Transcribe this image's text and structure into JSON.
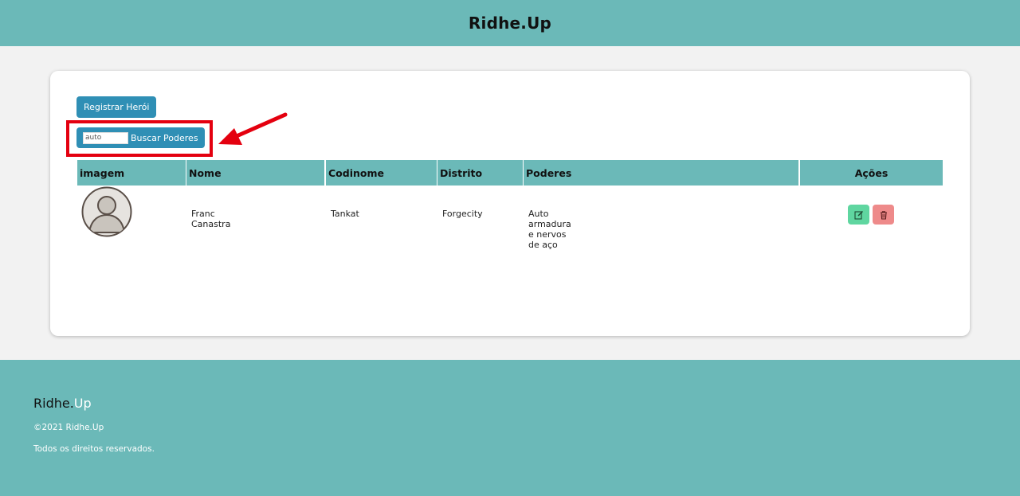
{
  "header": {
    "brand": "Ridhe.Up"
  },
  "actions": {
    "register_label": "Registrar Herói",
    "search_value": "auto",
    "search_button_label": "Buscar Poderes"
  },
  "table": {
    "columns": [
      "imagem",
      "Nome",
      "Codinome",
      "Distrito",
      "Poderes",
      "Ações"
    ],
    "rows": [
      {
        "avatar_icon": "user-avatar-icon",
        "nome": "Franc Canastra",
        "codinome": "Tankat",
        "distrito": "Forgecity",
        "poderes": "Auto armadura e nervos de aço",
        "edit_icon": "edit-icon",
        "delete_icon": "trash-icon"
      }
    ]
  },
  "footer": {
    "brand_part1": "Ridhe.",
    "brand_part2": "Up",
    "copyright": "©2021 Ridhe.Up",
    "rights": "Todos os direitos reservados."
  },
  "colors": {
    "teal": "#6bb9b8",
    "button_blue": "#2f8fb5",
    "edit_green": "#5fd6a0",
    "delete_red": "#ee8a8a",
    "annotation_red": "#e4000f"
  }
}
